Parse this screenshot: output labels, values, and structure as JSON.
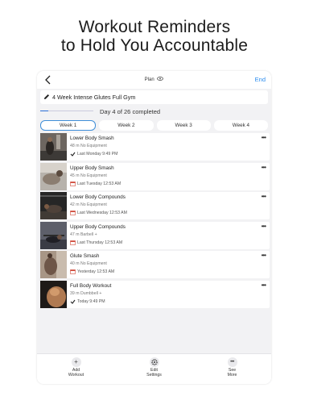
{
  "headline": {
    "line1": "Workout Reminders",
    "line2": "to Hold You Accountable"
  },
  "nav": {
    "title": "Plan",
    "end_label": "End"
  },
  "plan": {
    "name": "4 Week Intense Glutes Full Gym",
    "progress_text": "Day 4 of 26 completed",
    "progress_fraction": 0.154
  },
  "weeks": [
    {
      "label": "Week 1",
      "active": true
    },
    {
      "label": "Week 2",
      "active": false
    },
    {
      "label": "Week 3",
      "active": false
    },
    {
      "label": "Week 4",
      "active": false
    }
  ],
  "workouts": [
    {
      "name": "Lower Body Smash",
      "meta": "48 m   No Equipment",
      "last": "Last Monday 9:49 PM",
      "status": "check"
    },
    {
      "name": "Upper Body Smash",
      "meta": "45 m   No Equipment",
      "last": "Last Tuesday 12:53 AM",
      "status": "calendar"
    },
    {
      "name": "Lower Body Compounds",
      "meta": "42 m   No Equipment",
      "last": "Last Wednesday 12:53 AM",
      "status": "calendar"
    },
    {
      "name": "Upper Body Compounds",
      "meta": "47 m   Barbell +",
      "last": "Last Thursday 12:53 AM",
      "status": "calendar"
    },
    {
      "name": "Glute Smash",
      "meta": "40 m   No Equipment",
      "last": "Yesterday 12:53 AM",
      "status": "calendar"
    },
    {
      "name": "Full Body Workout",
      "meta": "39 m   Dumbbell +",
      "last": "Today 9:49 PM",
      "status": "check"
    }
  ],
  "toolbar": {
    "add_label": "Add\nWorkout",
    "edit_label": "Edit\nSettings",
    "more_label": "See\nMore"
  },
  "colors": {
    "accent": "#2b8cef",
    "progress": "#2b6fd6",
    "background": "#f2f2f4"
  }
}
